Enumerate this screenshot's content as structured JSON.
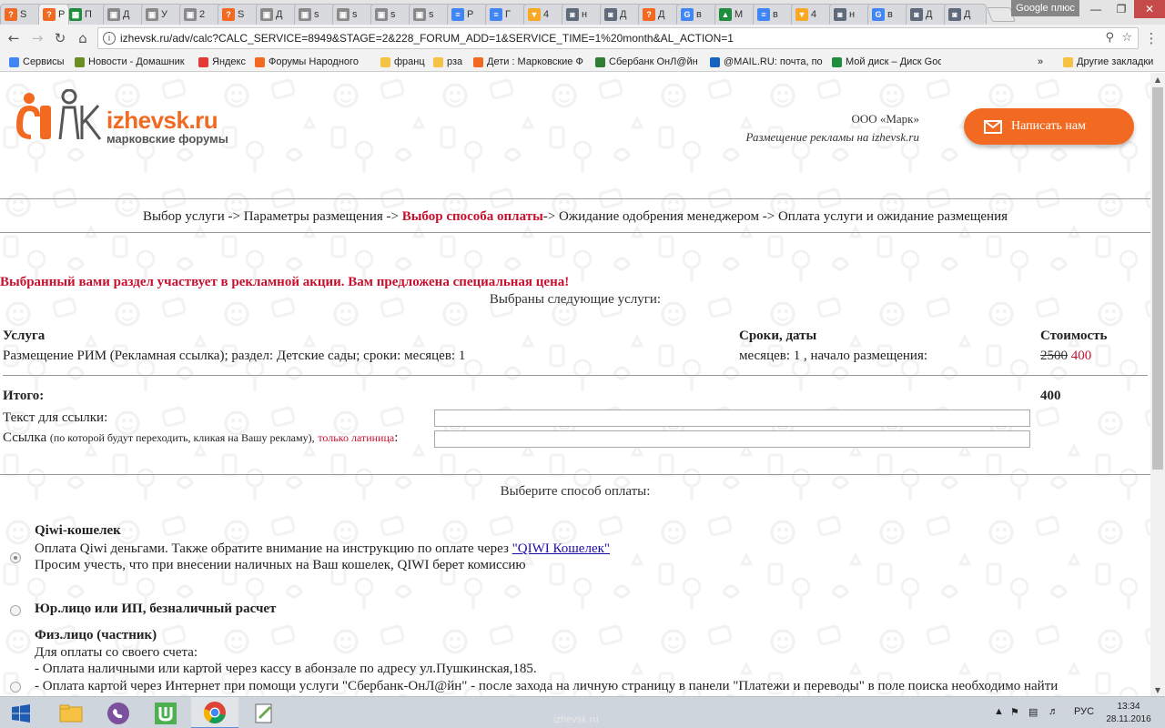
{
  "browser": {
    "tabs": [
      {
        "label": "S",
        "color": "#f26a21",
        "glyph": "?"
      },
      {
        "label": "Р",
        "color": "#f26a21",
        "glyph": "?",
        "active": true
      },
      {
        "label": "П",
        "color": "#1e8e3e",
        "glyph": "▦"
      },
      {
        "label": "Д",
        "color": "#8a8a8a",
        "glyph": "▣"
      },
      {
        "label": "У",
        "color": "#8a8a8a",
        "glyph": "▣"
      },
      {
        "label": "2",
        "color": "#8a8a8a",
        "glyph": "▣"
      },
      {
        "label": "S",
        "color": "#f26a21",
        "glyph": "?"
      },
      {
        "label": "Д",
        "color": "#8a8a8a",
        "glyph": "▣"
      },
      {
        "label": "s",
        "color": "#8a8a8a",
        "glyph": "▣"
      },
      {
        "label": "s",
        "color": "#8a8a8a",
        "glyph": "▣"
      },
      {
        "label": "s",
        "color": "#8a8a8a",
        "glyph": "▣"
      },
      {
        "label": "s",
        "color": "#8a8a8a",
        "glyph": "▣"
      },
      {
        "label": "Р",
        "color": "#4285f4",
        "glyph": "≡"
      },
      {
        "label": "Г",
        "color": "#4285f4",
        "glyph": "≡"
      },
      {
        "label": "4",
        "color": "#f9a825",
        "glyph": "▼"
      },
      {
        "label": "н",
        "color": "#5f6b7a",
        "glyph": "◙"
      },
      {
        "label": "Д",
        "color": "#5f6b7a",
        "glyph": "◙"
      },
      {
        "label": "Д",
        "color": "#f26a21",
        "glyph": "?"
      },
      {
        "label": "в",
        "color": "#4285f4",
        "glyph": "G"
      },
      {
        "label": "М",
        "color": "#1e8e3e",
        "glyph": "▲"
      },
      {
        "label": "в",
        "color": "#4285f4",
        "glyph": "≡"
      },
      {
        "label": "4",
        "color": "#f9a825",
        "glyph": "▼"
      },
      {
        "label": "н",
        "color": "#5f6b7a",
        "glyph": "◙"
      },
      {
        "label": "в",
        "color": "#4285f4",
        "glyph": "G"
      },
      {
        "label": "Д",
        "color": "#5f6b7a",
        "glyph": "◙"
      },
      {
        "label": "Д",
        "color": "#5f6b7a",
        "glyph": "◙"
      }
    ],
    "profile_label": "Google плюс",
    "url": "izhevsk.ru/adv/calc?CALC_SERVICE=8949&STAGE=2&228_FORUM_ADD=1&SERVICE_TIME=1%20month&AL_ACTION=1",
    "bookmarks": [
      {
        "label": "Сервисы",
        "color": "#4285f4"
      },
      {
        "label": "Новости - Домашник",
        "color": "#6b8e23"
      },
      {
        "label": "Яндекс",
        "color": "#e53935"
      },
      {
        "label": "Форумы Народного",
        "color": "#f26a21"
      },
      {
        "label": "франц",
        "color": "#f6c244"
      },
      {
        "label": "рза",
        "color": "#f6c244"
      },
      {
        "label": "Дети : Марковские Ф",
        "color": "#f26a21"
      },
      {
        "label": "Сбербанк ОнЛ@йн",
        "color": "#2e7d32"
      },
      {
        "label": "@MAIL.RU: почта, по",
        "color": "#1565c0"
      },
      {
        "label": "Мой диск – Диск Goo",
        "color": "#1e8e3e"
      }
    ],
    "bookmarks_more": "»",
    "other_bookmarks": "Другие закладки"
  },
  "header": {
    "logo_name": "izhevsk.ru",
    "logo_sub": "марковские форумы",
    "company": "ООО «Марк»",
    "tagline": "Размещение рекламы на izhevsk.ru",
    "write_button": "Написать нам"
  },
  "steps": {
    "s1": "Выбор услуги ->",
    "s2": "Параметры размещения ->",
    "current": "Выбор способа оплаты",
    "s3": "->",
    "s4": "Ожидание одобрения менеджером ->",
    "s5": "Оплата услуги и ожидание размещения"
  },
  "promo": "Выбранный вами раздел участвует в рекламной акции. Вам предложена специальная цена!",
  "selected_heading": "Выбраны следующие услуги:",
  "table": {
    "col_service": "Услуга",
    "col_dates": "Сроки, даты",
    "col_cost": "Стоимость",
    "row_service": "Размещение РИМ (Рекламная ссылка); раздел: Детские сады; сроки: месяцев: 1",
    "row_dates": "месяцев: 1 , начало размещения:",
    "old_price": "2500",
    "new_price": "400",
    "total_label": "Итого:",
    "total_value": "400"
  },
  "form": {
    "link_text_label": "Текст для ссылки:",
    "link_label_a": "Ссылка",
    "link_label_hint": "(по которой будут переходить, кликая на Вашу рекламу),",
    "link_label_latin": "только латиница",
    "link_label_colon": ":"
  },
  "payment": {
    "heading": "Выберите способ оплаты:",
    "qiwi_title": "Qiwi-кошелек",
    "qiwi_line1": "Оплата Qiwi деньгами. Также обратите внимание на инструкцию по оплате через",
    "qiwi_link": "\"QIWI Кошелек\"",
    "qiwi_line2": "Просим учесть, что при внесении наличных на Ваш кошелек, QIWI берет комиссию",
    "legal_title": "Юр.лицо или ИП, безналичный расчет",
    "person_title": "Физ.лицо (частник)",
    "person_line1": "Для оплаты со своего счета:",
    "person_line2": "- Оплата наличными или картой через кассу в абонзале по адресу ул.Пушкинская,185.",
    "person_line3": "- Оплата картой через Интернет при помощи услуги \"Сбербанк-ОнЛ@йн\" - после захода на личную страницу в панели \"Платежи и переводы\" в поле поиска необходимо найти"
  },
  "taskbar": {
    "lang": "РУС",
    "time": "13:34",
    "date": "28.11.2016",
    "status_url": "izhevsk.ru"
  }
}
